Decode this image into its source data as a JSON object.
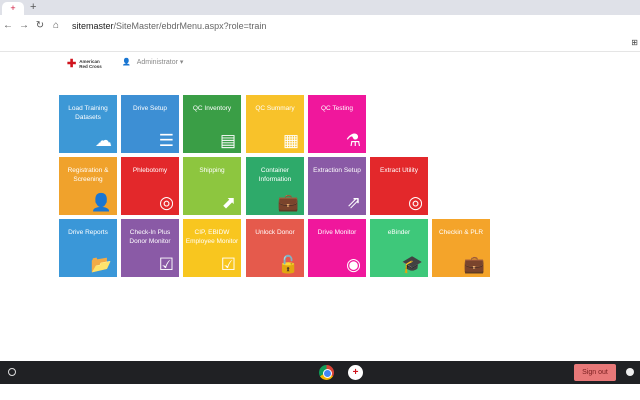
{
  "browser": {
    "tab_icon": "+",
    "new_tab": "+",
    "url_host": "sitemaster",
    "url_path": "/SiteMaster/ebdrMenu.aspx?role=train",
    "ext_icon": "⊞"
  },
  "header": {
    "logo_line1": "American",
    "logo_line2": "Red Cross",
    "user_label": "Administrator ▾"
  },
  "tiles": [
    {
      "label": "Load Training Datasets",
      "color": "#3d98d6",
      "icon": "☁"
    },
    {
      "label": "Drive Setup",
      "color": "#3d8fd4",
      "icon": "☰"
    },
    {
      "label": "QC Inventory",
      "color": "#3a9e46",
      "icon": "▤"
    },
    {
      "label": "QC Summary",
      "color": "#f8c22a",
      "icon": "▦"
    },
    {
      "label": "QC Testing",
      "color": "#f0179c",
      "icon": "⚗"
    },
    {
      "label": "Registration & Screening",
      "color": "#f0a22c",
      "icon": "👤"
    },
    {
      "label": "Phlebotomy",
      "color": "#e3282b",
      "icon": "◎"
    },
    {
      "label": "Shipping",
      "color": "#8dc63f",
      "icon": "⬈"
    },
    {
      "label": "Container Information",
      "color": "#2eaa6a",
      "icon": "💼"
    },
    {
      "label": "Extraction Setup",
      "color": "#8a5aa6",
      "icon": "⇗"
    },
    {
      "label": "Extract Utility",
      "color": "#e3282b",
      "icon": "◎"
    },
    {
      "label": "Drive Reports",
      "color": "#3a97d8",
      "icon": "📂"
    },
    {
      "label": "Check-In Plus Donor Monitor",
      "color": "#8a5aa6",
      "icon": "☑"
    },
    {
      "label": "CIP, EBIDW Employee Monitor",
      "color": "#f8c61f",
      "icon": "☑"
    },
    {
      "label": "Unlock Donor",
      "color": "#e55a4c",
      "icon": "🔓"
    },
    {
      "label": "Drive Monitor",
      "color": "#f0179c",
      "icon": "◉"
    },
    {
      "label": "eBinder",
      "color": "#3ec87a",
      "icon": "🎓"
    },
    {
      "label": "Checkin & PLR",
      "color": "#f4a42a",
      "icon": "💼"
    }
  ],
  "taskbar": {
    "signout_label": "Sign out",
    "arc_icon": "+"
  }
}
